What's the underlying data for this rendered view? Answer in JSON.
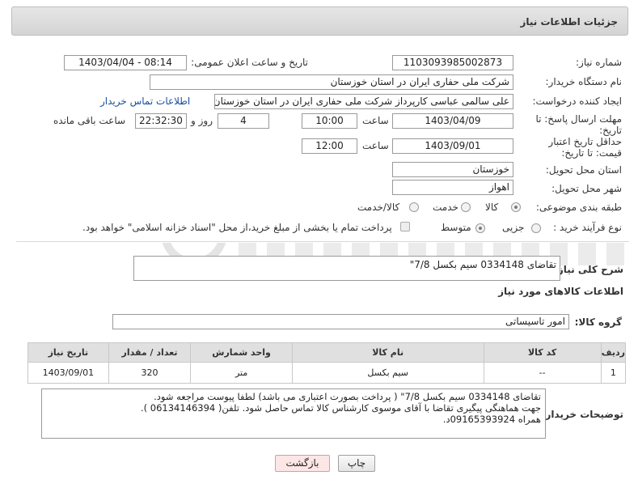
{
  "header": {
    "title": "جزئیات اطلاعات نیاز"
  },
  "form": {
    "need_number_label": "شماره نیاز:",
    "need_number": "1103093985002873",
    "announce_label": "تاریخ و ساعت اعلان عمومی:",
    "announce_value": "1403/04/04 - 08:14",
    "buyer_org_label": "نام دستگاه خریدار:",
    "buyer_org": "شرکت ملی حفاری ایران در استان خوزستان",
    "creator_label": "ایجاد کننده درخواست:",
    "creator": "علی سالمی عباسی کارپرداز شرکت ملی حفاری ایران در استان خوزستان",
    "contact_link": "اطلاعات تماس خریدار",
    "reply_deadline_label": "مهلت ارسال پاسخ: تا تاریخ:",
    "reply_date": "1403/04/09",
    "time_label": "ساعت",
    "reply_time": "10:00",
    "days_value": "4",
    "days_label": "روز و",
    "remaining_value": "22:32:30",
    "remaining_label": "ساعت باقی مانده",
    "price_validity_label": "حداقل تاریخ اعتبار قیمت: تا تاریخ:",
    "price_date": "1403/09/01",
    "price_time": "12:00",
    "province_label": "استان محل تحویل:",
    "province": "خوزستان",
    "city_label": "شهر محل تحویل:",
    "city": "اهواز",
    "category_label": "طبقه بندی موضوعی:",
    "category_options": [
      "کالا",
      "خدمت",
      "کالا/خدمت"
    ],
    "process_label": "نوع فرآیند خرید :",
    "process_options": [
      "جزیی",
      "متوسط"
    ],
    "payment_note": "پرداخت تمام یا بخشی از مبلغ خرید،از محل \"اسناد خزانه اسلامی\" خواهد بود."
  },
  "summary": {
    "label": "شرح کلی نیاز:",
    "value": "تقاضای 0334148 سیم بکسل 7/8\""
  },
  "goods": {
    "section_title": "اطلاعات کالاهای مورد نیاز",
    "group_label": "گروه کالا:",
    "group_value": "امور تاسیساتی"
  },
  "table": {
    "headers": [
      "ردیف",
      "کد کالا",
      "نام کالا",
      "واحد شمارش",
      "تعداد / مقدار",
      "تاریخ نیاز"
    ],
    "rows": [
      [
        "1",
        "--",
        "سیم بکسل",
        "متر",
        "320",
        "1403/09/01"
      ]
    ]
  },
  "buyer_notes": {
    "label": "توضیحات خریدار:",
    "lines": [
      "تقاضای 0334148 سیم بکسل 7/8\" ( پرداخت بصورت اعتباری می باشد) لطفا پیوست مراجعه شود.",
      "جهت هماهنگی پیگیری تقاضا با آقای موسوی کارشناس کالا تماس حاصل شود.  تلفن( 06134146394 ).",
      "همراه 09165393924د."
    ]
  },
  "buttons": {
    "print": "چاپ",
    "back": "بازگشت"
  }
}
